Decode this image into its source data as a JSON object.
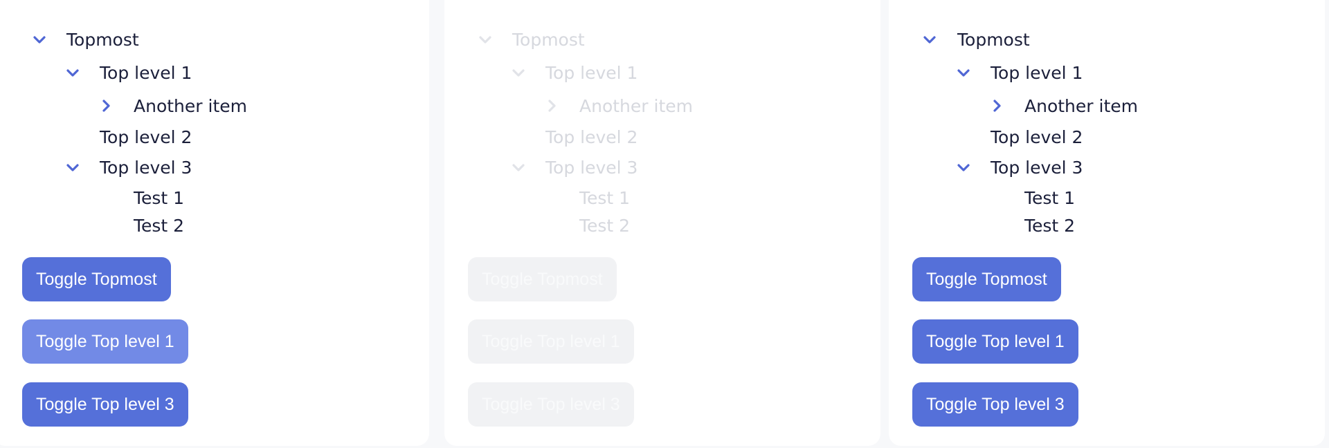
{
  "columns": [
    {
      "state": "enabled",
      "tree": {
        "topmost": "Topmost",
        "top_level_1": "Top level 1",
        "another_item": "Another item",
        "top_level_2": "Top level 2",
        "top_level_3": "Top level 3",
        "test_1": "Test 1",
        "test_2": "Test 2"
      },
      "buttons": {
        "toggle_topmost": "Toggle Topmost",
        "toggle_top_level_1": "Toggle Top level 1",
        "toggle_top_level_3": "Toggle Top level 3"
      }
    },
    {
      "state": "disabled",
      "tree": {
        "topmost": "Topmost",
        "top_level_1": "Top level 1",
        "another_item": "Another item",
        "top_level_2": "Top level 2",
        "top_level_3": "Top level 3",
        "test_1": "Test 1",
        "test_2": "Test 2"
      },
      "buttons": {
        "toggle_topmost": "Toggle Topmost",
        "toggle_top_level_1": "Toggle Top level 1",
        "toggle_top_level_3": "Toggle Top level 3"
      }
    },
    {
      "state": "enabled",
      "tree": {
        "topmost": "Topmost",
        "top_level_1": "Top level 1",
        "another_item": "Another item",
        "top_level_2": "Top level 2",
        "top_level_3": "Top level 3",
        "test_1": "Test 1",
        "test_2": "Test 2"
      },
      "buttons": {
        "toggle_topmost": "Toggle Topmost",
        "toggle_top_level_1": "Toggle Top level 1",
        "toggle_top_level_3": "Toggle Top level 3"
      }
    }
  ],
  "colors": {
    "accent": "#5570d9",
    "accent_hover": "#728ae6",
    "text": "#1b1f3a",
    "disabled_text": "#d6d8de",
    "disabled_button": "#f1f2f4"
  },
  "icons": {
    "expanded": "chevron-down-icon",
    "collapsed": "chevron-right-icon"
  }
}
